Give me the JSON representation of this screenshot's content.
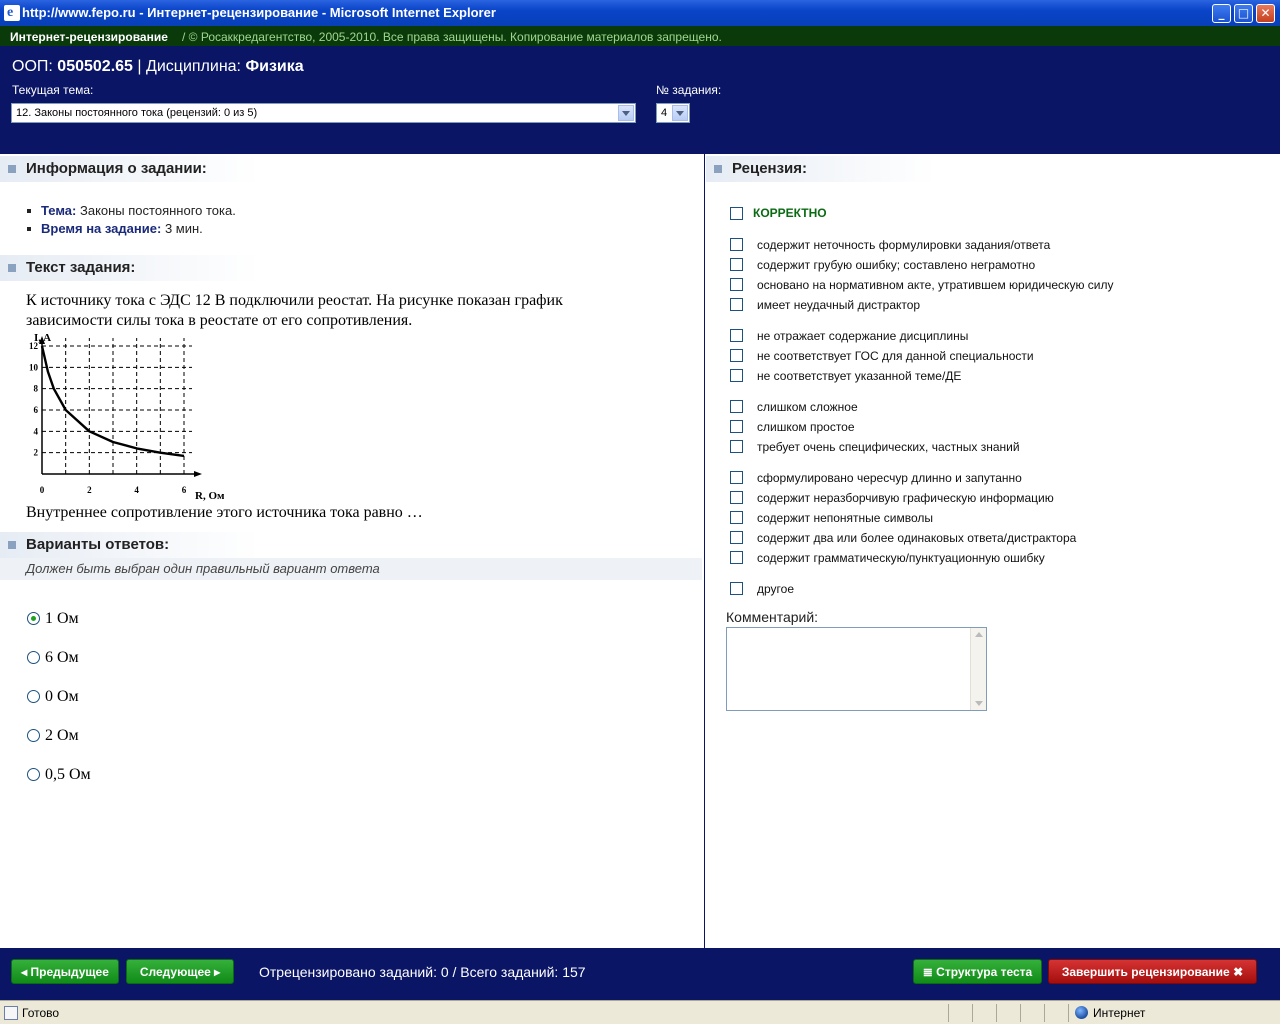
{
  "window": {
    "title": "http://www.fepo.ru - Интернет-рецензирование - Microsoft Internet Explorer",
    "minimize": "_",
    "maximize": "□",
    "close": "✕"
  },
  "strip": {
    "app_name": "Интернет-рецензирование",
    "copyright": "/  © Росаккредагентство, 2005-2010. Все права защищены. Копирование материалов запрещено."
  },
  "header": {
    "oop_label": "ООП:",
    "oop_value": "050502.65",
    "separator": "|",
    "discipline_label": "Дисциплина:",
    "discipline_value": "Физика",
    "topic_label": "Текущая тема:",
    "topic_value": "12. Законы постоянного тока  (рецензий: 0 из 5)",
    "task_no_label": "№ задания:",
    "task_no_value": "4"
  },
  "info": {
    "title": "Информация о задании:",
    "topic_label": "Тема:",
    "topic_value": "Законы постоянного тока.",
    "time_label": "Время на задание:",
    "time_value": "3 мин."
  },
  "task": {
    "title": "Текст задания:",
    "line1": "К источнику тока с ЭДС 12 В подключили реостат. На рисунке показан график",
    "line2": "зависимости силы тока в реостате от его сопротивления.",
    "question": "Внутреннее сопротивление этого источника тока равно …"
  },
  "chart_data": {
    "type": "line",
    "xlabel": "R, Ом",
    "ylabel": "I, A",
    "xticks": [
      "0",
      "2",
      "4",
      "6"
    ],
    "yticks": [
      "2",
      "4",
      "6",
      "8",
      "10",
      "12"
    ],
    "xlim": [
      0,
      6
    ],
    "ylim": [
      0,
      12
    ],
    "grid": true,
    "x": [
      0,
      0.25,
      0.5,
      1,
      2,
      3,
      4,
      5,
      6
    ],
    "y": [
      12,
      9.6,
      8,
      6,
      4,
      3,
      2.4,
      2,
      1.7
    ]
  },
  "answers": {
    "title": "Варианты ответов:",
    "hint": "Должен быть выбран один правильный вариант ответа",
    "options": [
      "1 Ом",
      "6 Ом",
      "0 Ом",
      "2 Ом",
      "0,5 Ом"
    ]
  },
  "review": {
    "title": "Рецензия:",
    "correct": "КОРРЕКТНО",
    "items": [
      "содержит неточность формулировки задания/ответа",
      "содержит грубую ошибку; составлено неграмотно",
      "основано на нормативном акте, утратившем юридическую силу",
      "имеет неудачный дистрактор",
      "не отражает содержание дисциплины",
      "не соответствует ГОС для данной специальности",
      "не соответствует указанной теме/ДЕ",
      "слишком сложное",
      "слишком простое",
      "требует очень специфических, частных знаний",
      "сформулировано чересчур длинно и запутанно",
      "содержит неразборчивую графическую информацию",
      "содержит непонятные символы",
      "содержит два или более одинаковых ответа/дистрактора",
      "содержит грамматическую/пунктуационную ошибку",
      "другое"
    ],
    "comment_label": "Комментарий:"
  },
  "footer": {
    "prev": "Предыдущее",
    "next": "Следующее",
    "progress": "Отрецензировано заданий: 0 / Всего заданий:  157",
    "structure": "Структура теста",
    "finish": "Завершить рецензирование"
  },
  "statusbar": {
    "left": "Готово",
    "zone": "Интернет"
  },
  "colors": {
    "navy": "#0a1565",
    "green_btn": "#1a961f",
    "red_btn": "#b71515"
  }
}
